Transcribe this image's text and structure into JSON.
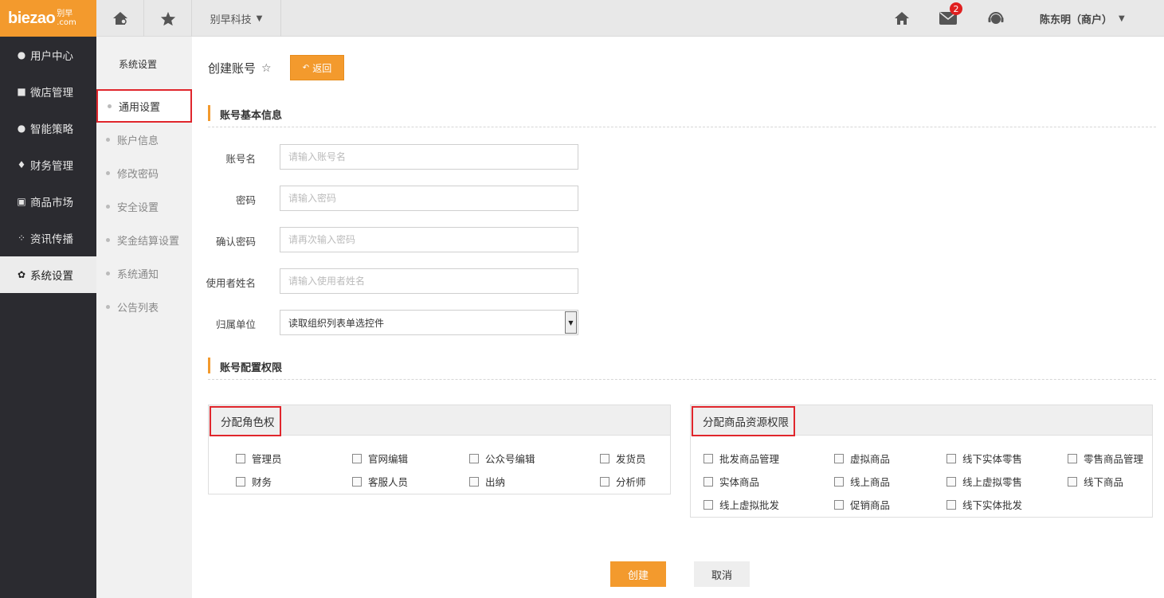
{
  "brand": {
    "logo_text": "biezao",
    "logo_cn": "别早",
    "logo_domain": ".com",
    "accent_color": "#f39a2d",
    "highlight_color": "#e0262c"
  },
  "topbar": {
    "company": "别早科技",
    "mail_badge": "2",
    "user": "陈东明（商户）"
  },
  "leftnav": [
    {
      "label": "用户中心",
      "icon": "user-icon"
    },
    {
      "label": "微店管理",
      "icon": "shop-icon"
    },
    {
      "label": "智能策略",
      "icon": "strategy-icon"
    },
    {
      "label": "财务管理",
      "icon": "money-bag-icon"
    },
    {
      "label": "商品市场",
      "icon": "market-icon"
    },
    {
      "label": "资讯传播",
      "icon": "grid-icon"
    },
    {
      "label": "系统设置",
      "icon": "gear-icon",
      "active": true
    }
  ],
  "subnav": {
    "title": "系统设置",
    "items": [
      "通用设置",
      "账户信息",
      "修改密码",
      "安全设置",
      "奖金结算设置",
      "系统通知",
      "公告列表"
    ]
  },
  "page": {
    "title": "创建账号",
    "back_label": "返回"
  },
  "section1": "账号基本信息",
  "form": {
    "account_label": "账号名",
    "account_placeholder": "请输入账号名",
    "password_label": "密码",
    "password_placeholder": "请输入密码",
    "confirm_label": "确认密码",
    "confirm_placeholder": "请再次输入密码",
    "username_label": "使用者姓名",
    "username_placeholder": "请输入使用者姓名",
    "org_label": "归属单位",
    "org_value": "读取组织列表单选控件"
  },
  "section2": "账号配置权限",
  "roles": {
    "title": "分配角色权",
    "items": [
      "管理员",
      "官网编辑",
      "公众号编辑",
      "发货员",
      "财务",
      "客服人员",
      "出纳",
      "分析师"
    ]
  },
  "resources": {
    "title": "分配商品资源权限",
    "items": [
      "批发商品管理",
      "虚拟商品",
      "线下实体零售",
      "零售商品管理",
      "实体商品",
      "线上商品",
      "线上虚拟零售",
      "线下商品",
      "线上虚拟批发",
      "促销商品",
      "线下实体批发"
    ]
  },
  "actions": {
    "create": "创建",
    "cancel": "取消"
  }
}
